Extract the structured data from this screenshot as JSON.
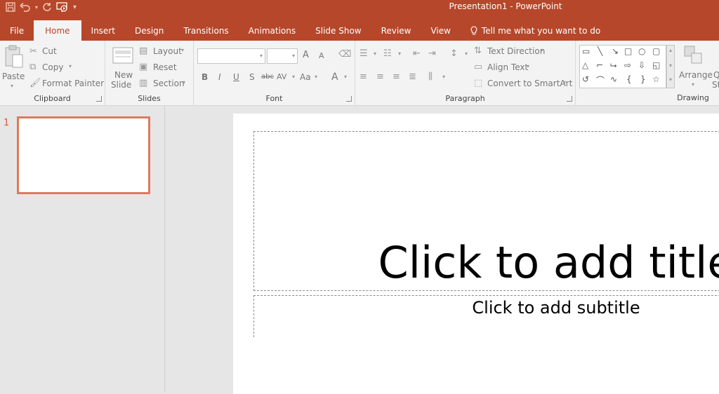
{
  "window": {
    "title": "Presentation1  -  PowerPoint"
  },
  "qat": {
    "save_icon": "save-icon",
    "undo_icon": "undo-icon",
    "redo_icon": "redo-icon",
    "present_icon": "start-from-beginning-icon",
    "customize_icon": "customize-qat-icon"
  },
  "tabs": [
    {
      "label": "File"
    },
    {
      "label": "Home"
    },
    {
      "label": "Insert"
    },
    {
      "label": "Design"
    },
    {
      "label": "Transitions"
    },
    {
      "label": "Animations"
    },
    {
      "label": "Slide Show"
    },
    {
      "label": "Review"
    },
    {
      "label": "View"
    }
  ],
  "tellme": {
    "label": "Tell me what you want to do"
  },
  "ribbon": {
    "clipboard": {
      "label": "Clipboard",
      "paste": "Paste",
      "cut": "Cut",
      "copy": "Copy",
      "format_painter": "Format Painter"
    },
    "slides": {
      "label": "Slides",
      "new_slide_1": "New",
      "new_slide_2": "Slide",
      "layout": "Layout",
      "reset": "Reset",
      "section": "Section"
    },
    "font": {
      "label": "Font",
      "bold": "B",
      "italic": "I",
      "underline": "U",
      "shadow": "S",
      "strike": "abc",
      "spacing": "AV",
      "case": "Aa",
      "color": "A",
      "grow": "A",
      "shrink": "A"
    },
    "paragraph": {
      "label": "Paragraph",
      "text_direction": "Text Direction",
      "align_text": "Align Text",
      "smartart": "Convert to SmartArt"
    },
    "drawing": {
      "label": "Drawing",
      "arrange": "Arrange",
      "quick_styles_1": "Q",
      "quick_styles_2": "St"
    }
  },
  "thumbnails": [
    {
      "number": "1"
    }
  ],
  "slide": {
    "title_placeholder": "Click to add title",
    "subtitle_placeholder": "Click to add subtitle"
  },
  "colors": {
    "accent": "#b7472a",
    "selection": "#e0795e"
  }
}
